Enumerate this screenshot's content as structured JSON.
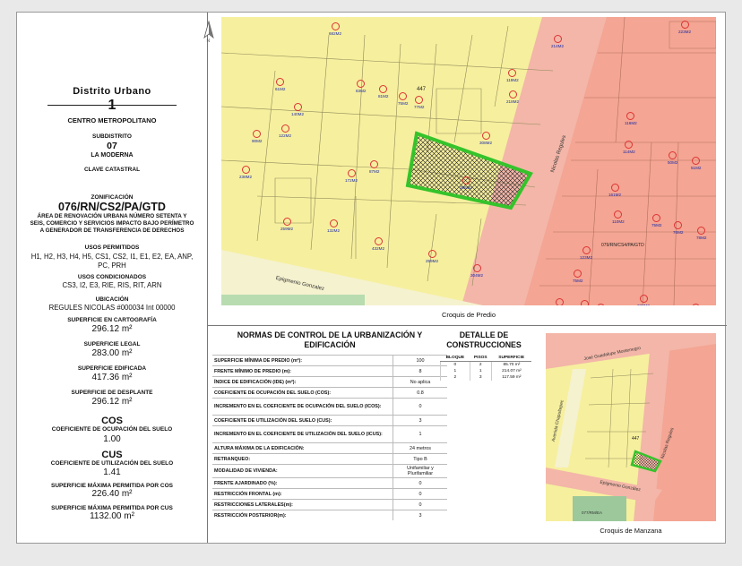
{
  "left_panel": {
    "district_title": "Distrito Urbano",
    "district_number": "1",
    "district_name": "CENTRO METROPOLITANO",
    "subdistrict_label": "SUBDISTRITO",
    "subdistrict_number": "07",
    "subdistrict_name": "LA MODERNA",
    "cadastral_label": "CLAVE CATASTRAL",
    "zoning_label": "ZONIFICACIÓN",
    "zoning_code": "076/RN/CS2/PA/GTD",
    "zoning_desc": "ÁREA DE RENOVACIÓN URBANA NÚMERO SETENTA Y SEIS, COMERCIO Y SERVICIOS IMPACTO BAJO PERÍMETRO A GENERADOR DE TRANSFERENCIA DE DERECHOS",
    "permitted_label": "USOS PERMITIDOS",
    "permitted_values": "H1, H2, H3, H4, H5, CS1, CS2, I1, E1, E2, EA, ANP, PC, PRH",
    "conditioned_label": "USOS CONDICIONADOS",
    "conditioned_values": "CS3, I2, E3, RIE, RIS, RIT, ARN",
    "location_label": "UBICACIÓN",
    "location_value": "REGULES NICOLAS #000034 Int 00000",
    "surf_carto_label": "SUPERFICIE EN CARTOGRAFÍA",
    "surf_carto_value": "296.12 m²",
    "surf_legal_label": "SUPERFICIE LEGAL",
    "surf_legal_value": "283.00 m²",
    "surf_built_label": "SUPERFICIE EDIFICADA",
    "surf_built_value": "417.36 m²",
    "surf_desplante_label": "SUPERFICIE DE DESPLANTE",
    "surf_desplante_value": "296.12 m²",
    "cos_title": "COS",
    "cos_label": "COEFICIENTE DE OCUPACIÓN DEL SUELO",
    "cos_value": "1.00",
    "cus_title": "CUS",
    "cus_label": "COEFICIENTE DE UTILIZACIÓN DEL SUELO",
    "cus_value": "1.41",
    "max_cos_label": "SUPERFICIE MÁXIMA PERMITIDA POR COS",
    "max_cos_value": "226.40 m²",
    "max_cus_label": "SUPERFICIE MÁXIMA PERMITIDA POR CUS",
    "max_cus_value": "1132.00 m²"
  },
  "map_predio": {
    "caption": "Croquis de Predio",
    "street_1": "Nicolas Regules",
    "street_2": "Epigmenio Gonzalez",
    "zone_label": "079/RN/CS4/PA/GTD",
    "lot_number": "447",
    "labels": [
      "682M2",
      "214M2",
      "223M2",
      "61M2",
      "83M2",
      "81M2",
      "75M2",
      "77M2",
      "119M2",
      "140M2",
      "218M2",
      "122M2",
      "90M2",
      "308M2",
      "116M2",
      "114M2",
      "50M2",
      "51M2",
      "87M2",
      "172M2",
      "296M2",
      "238M2",
      "161M2",
      "259M2",
      "132M2",
      "432M2",
      "110M2",
      "75M2",
      "76M2",
      "78M2",
      "259M2",
      "304M2",
      "123M2",
      "75M2",
      "86M2",
      "50M2",
      "42M2",
      "338M2",
      "253M2"
    ]
  },
  "map_manzana": {
    "caption": "Croquis de Manzana",
    "street_1": "José Guadalupe Montenegro",
    "street_2": "Avenida Chapultepec",
    "street_3": "Nicolas Regules",
    "street_4": "Epigmenio González",
    "zone_label": "077/RM/EA",
    "lot_number": "447"
  },
  "norms": {
    "title": "NORMAS DE CONTROL DE LA URBANIZACIÓN Y EDIFICACIÓN",
    "rows": [
      {
        "label": "SUPERFICIE MÍNIMA DE PREDIO (m²):",
        "value": "100"
      },
      {
        "label": "FRENTE MÍNIMO DE PREDIO (m):",
        "value": "8"
      },
      {
        "label": "ÍNDICE DE EDIFICACIÓN (IDE) (m²):",
        "value": "No aplica"
      },
      {
        "label": "COEFICIENTE DE OCUPACIÓN DEL SUELO (COS):",
        "value": "0.8"
      },
      {
        "label": "INCREMENTO EN EL COEFICIENTE DE OCUPACIÓN DEL SUELO (ICOS):",
        "value": "0"
      },
      {
        "label": "COEFICIENTE DE UTILIZACIÓN DEL SUELO (CUS):",
        "value": "3"
      },
      {
        "label": "INCREMENTO EN EL COEFICIENTE DE UTILIZACIÓN DEL SUELO (ICUS):",
        "value": "1"
      },
      {
        "label": "ALTURA MÁXIMA DE LA EDIFICACIÓN:",
        "value": "24 metros"
      },
      {
        "label": "RETRANQUEO:",
        "value": "Tipo B"
      },
      {
        "label": "MODALIDAD DE VIVIENDA:",
        "value": "Unifamiliar y Plurifamiliar"
      },
      {
        "label": "FRENTE AJARDINADO (%):",
        "value": "0"
      },
      {
        "label": "RESTRICCIÓN FRONTAL (m):",
        "value": "0"
      },
      {
        "label": "RESTRICCIONES LATERALES(m):",
        "value": "0"
      },
      {
        "label": "RESTRICCIÓN POSTERIOR(m):",
        "value": "3"
      }
    ]
  },
  "construction": {
    "title": "DETALLE DE CONSTRUCCIONES",
    "headers": [
      "BLOQUE",
      "PISOS",
      "SUPERFICIE"
    ],
    "rows": [
      [
        "0",
        "2",
        "85.70 m²"
      ],
      [
        "1",
        "1",
        "214.07 m²"
      ],
      [
        "2",
        "3",
        "117.59 m²"
      ]
    ]
  },
  "colors": {
    "lot_yellow": "#f6ef9e",
    "street_pink": "#f3b6a8",
    "pink_lot": "#f4a593",
    "highlight_green": "#35c32b",
    "park_green": "#9cc89c"
  }
}
